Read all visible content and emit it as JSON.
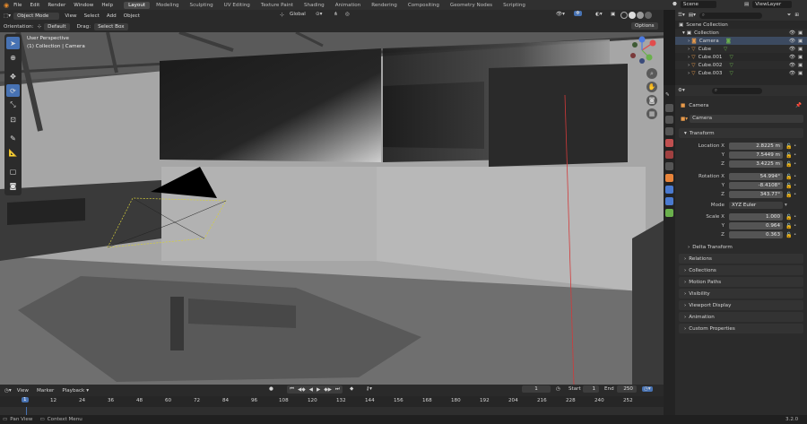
{
  "topbar": {
    "menu": [
      "File",
      "Edit",
      "Render",
      "Window",
      "Help"
    ],
    "workspaces": [
      "Layout",
      "Modeling",
      "Sculpting",
      "UV Editing",
      "Texture Paint",
      "Shading",
      "Animation",
      "Rendering",
      "Compositing",
      "Geometry Nodes",
      "Scripting"
    ],
    "active_workspace": "Layout",
    "scene": "Scene",
    "view_layer": "ViewLayer"
  },
  "viewport_header": {
    "mode": "Object Mode",
    "menus": [
      "View",
      "Select",
      "Add",
      "Object"
    ],
    "transform_orientation": "Global",
    "orientation_label": "Orientation:",
    "orientation_value": "Default",
    "drag_label": "Drag:",
    "drag_value": "Select Box",
    "options": "Options"
  },
  "viewport": {
    "overlay_title": "User Perspective",
    "overlay_subtitle": "(1) Collection | Camera"
  },
  "timeline": {
    "menus": [
      "View",
      "Marker",
      "Playback"
    ],
    "current_frame": "1",
    "start_label": "Start",
    "start": "1",
    "end_label": "End",
    "end": "250",
    "ruler": [
      "1",
      "12",
      "24",
      "36",
      "48",
      "60",
      "72",
      "84",
      "96",
      "108",
      "120",
      "132",
      "144",
      "156",
      "168",
      "180",
      "192",
      "204",
      "216",
      "228",
      "240",
      "252"
    ]
  },
  "statusbar": {
    "left1": "Pan View",
    "left2": "Context Menu",
    "version": "3.2.0"
  },
  "outliner": {
    "search_placeholder": "",
    "root": "Scene Collection",
    "collection": "Collection",
    "items": [
      "Camera",
      "Cube",
      "Cube.001",
      "Cube.002",
      "Cube.003"
    ]
  },
  "properties": {
    "object_name": "Camera",
    "datablock": "Camera",
    "transform_header": "Transform",
    "location_label": "Location X",
    "location": [
      "2.8225 m",
      "7.5449 m",
      "3.4225 m"
    ],
    "rotation_label": "Rotation X",
    "rotation": [
      "54.994°",
      "-8.4108°",
      "343.77°"
    ],
    "mode_label": "Mode",
    "mode_value": "XYZ Euler",
    "scale_label": "Scale X",
    "scale": [
      "1.000",
      "0.964",
      "0.363"
    ],
    "axis_y": "Y",
    "axis_z": "Z",
    "sections": [
      "Delta Transform",
      "Relations",
      "Collections",
      "Motion Paths",
      "Visibility",
      "Viewport Display",
      "Animation",
      "Custom Properties"
    ]
  }
}
